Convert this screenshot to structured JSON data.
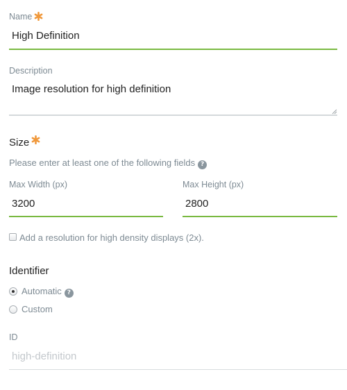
{
  "name_field": {
    "label": "Name",
    "value": "High Definition"
  },
  "description_field": {
    "label": "Description",
    "value": "Image resolution for high definition"
  },
  "size_section": {
    "title": "Size",
    "hint": "Please enter at least one of the following fields",
    "max_width": {
      "label": "Max Width (px)",
      "value": "3200"
    },
    "max_height": {
      "label": "Max Height (px)",
      "value": "2800"
    },
    "high_density_checkbox": {
      "label": "Add a resolution for high density displays (2x).",
      "checked": false
    }
  },
  "identifier_section": {
    "title": "Identifier",
    "options": [
      {
        "label": "Automatic",
        "selected": true
      },
      {
        "label": "Custom",
        "selected": false
      }
    ],
    "id_field": {
      "label": "ID",
      "placeholder": "high-definition"
    }
  },
  "colors": {
    "accent_green": "#79b940",
    "required_orange": "#f0983a",
    "label_gray": "#7d8a93"
  },
  "icons": {
    "required": "asterisk-icon",
    "help": "question-mark-icon"
  }
}
